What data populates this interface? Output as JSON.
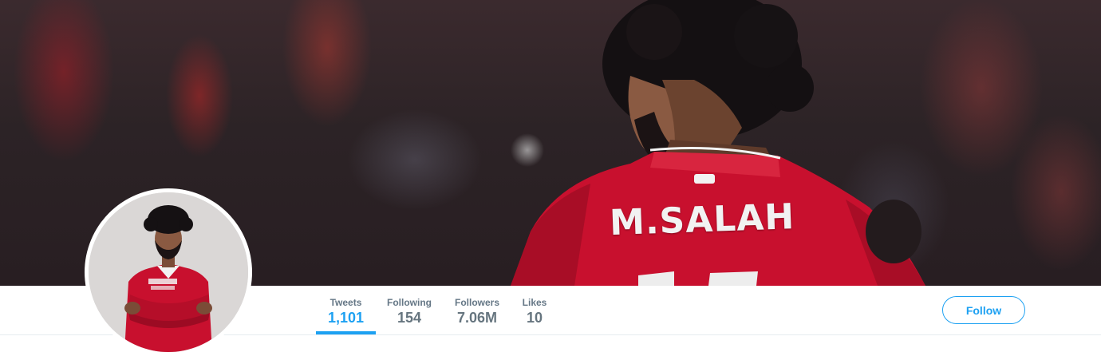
{
  "profile": {
    "banner": {
      "jersey_text": "M.SALAH"
    },
    "avatar": {
      "alt": "profile photo"
    }
  },
  "nav": {
    "stats": [
      {
        "label": "Tweets",
        "value": "1,101",
        "active": true
      },
      {
        "label": "Following",
        "value": "154",
        "active": false
      },
      {
        "label": "Followers",
        "value": "7.06M",
        "active": false
      },
      {
        "label": "Likes",
        "value": "10",
        "active": false
      }
    ],
    "follow_label": "Follow"
  },
  "colors": {
    "accent": "#1da1f2",
    "stat_label": "#657786",
    "stat_value": "#66757f",
    "jersey_red": "#c8102e"
  }
}
